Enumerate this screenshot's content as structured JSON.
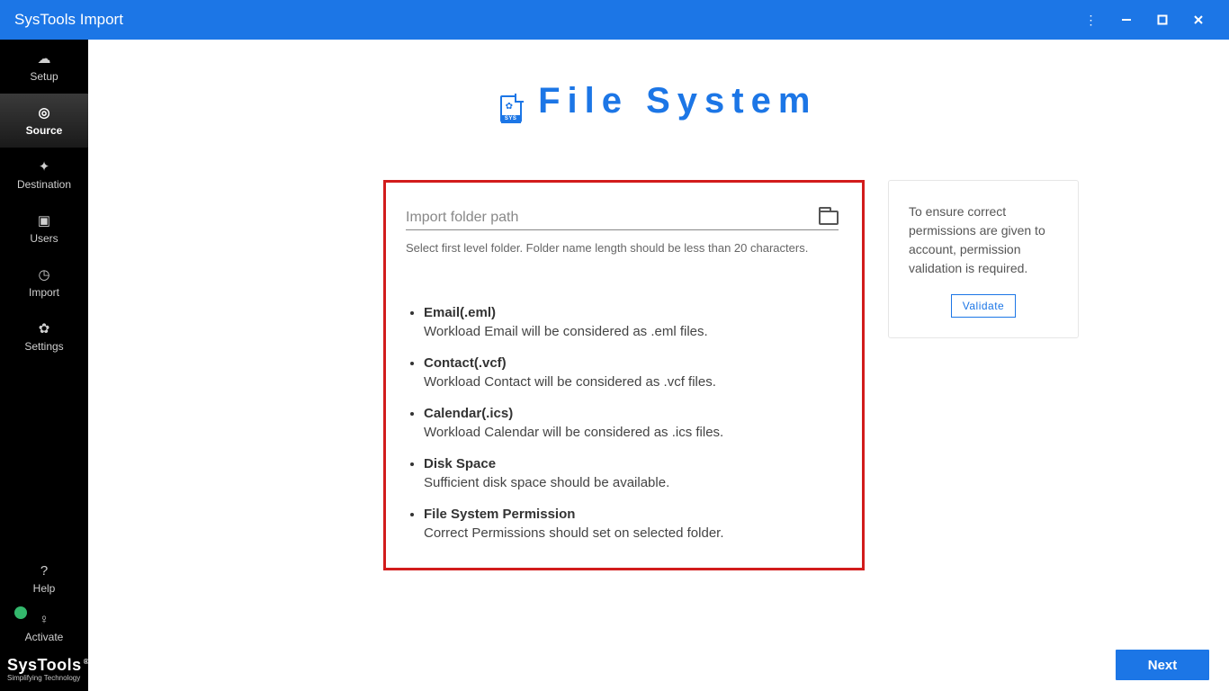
{
  "window": {
    "title": "SysTools Import"
  },
  "sidebar": {
    "items": [
      {
        "id": "setup",
        "label": "Setup"
      },
      {
        "id": "source",
        "label": "Source"
      },
      {
        "id": "destination",
        "label": "Destination"
      },
      {
        "id": "users",
        "label": "Users"
      },
      {
        "id": "import",
        "label": "Import"
      },
      {
        "id": "settings",
        "label": "Settings"
      }
    ],
    "bottom": [
      {
        "id": "help",
        "label": "Help"
      },
      {
        "id": "activate",
        "label": "Activate"
      }
    ],
    "brand": {
      "name": "SysTools",
      "tagline": "Simplifying Technology"
    }
  },
  "page": {
    "title": "File System",
    "sys_label": "SYS",
    "input_placeholder": "Import folder path",
    "helper": "Select first level folder. Folder name length should be less than 20 characters.",
    "notes": [
      {
        "title": "Email(.eml)",
        "desc": "Workload Email will be considered as .eml files."
      },
      {
        "title": "Contact(.vcf)",
        "desc": "Workload Contact will be considered as .vcf files."
      },
      {
        "title": "Calendar(.ics)",
        "desc": "Workload Calendar will be considered as .ics files."
      },
      {
        "title": "Disk Space",
        "desc": "Sufficient disk space should be available."
      },
      {
        "title": "File System Permission",
        "desc": "Correct Permissions should set on selected folder."
      }
    ],
    "side_card": {
      "text": "To ensure correct permissions are given to account, permission validation is required.",
      "button": "Validate"
    },
    "next_button": "Next"
  }
}
